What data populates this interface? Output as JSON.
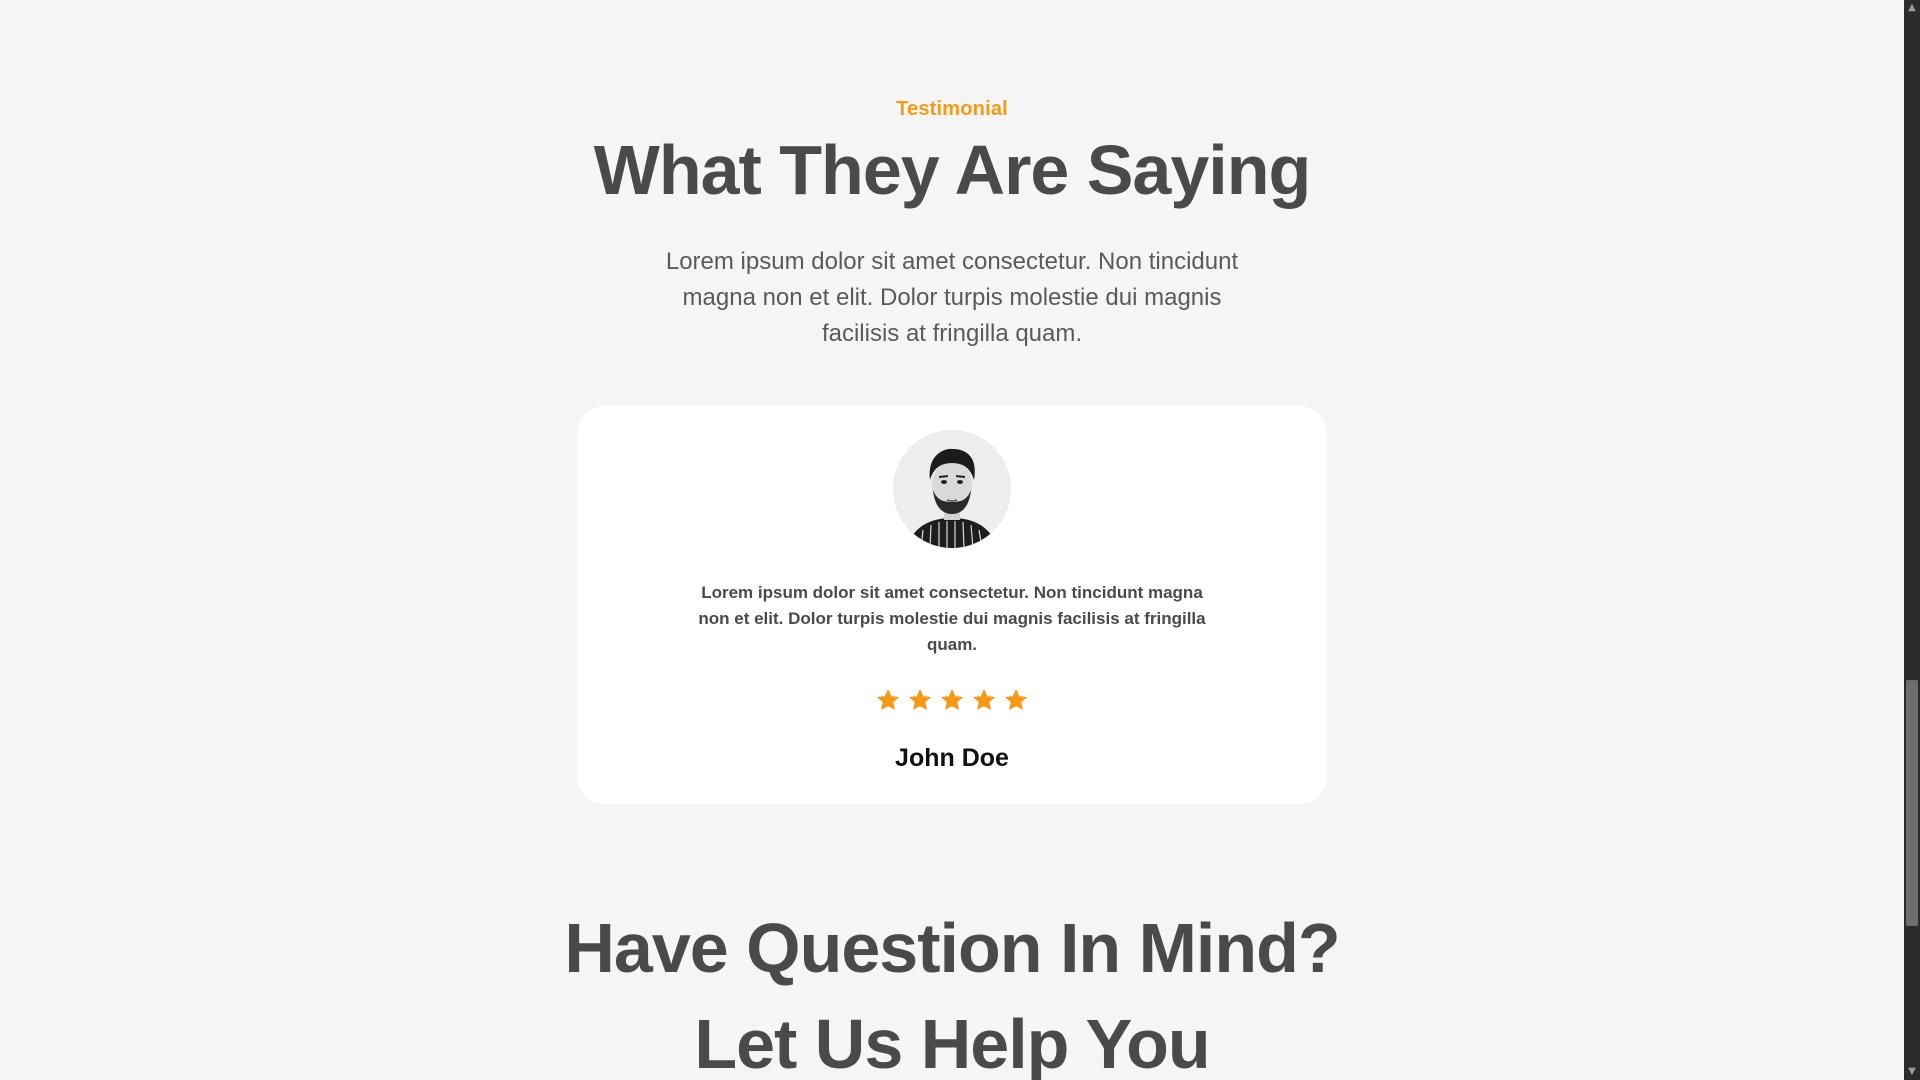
{
  "testimonial_section": {
    "eyebrow": "Testimonial",
    "title": "What They Are Saying",
    "description": "Lorem ipsum dolor sit amet consectetur. Non tincidunt magna non et elit. Dolor turpis molestie dui magnis facilisis at fringilla quam."
  },
  "testimonial_card": {
    "avatar_icon": "person-avatar",
    "quote": "Lorem ipsum dolor sit amet consectetur. Non tincidunt magna non et elit. Dolor turpis molestie dui magnis facilisis at fringilla quam.",
    "rating": 5,
    "rating_max": 5,
    "star_color": "#f59a16",
    "name": "John Doe"
  },
  "cta_section": {
    "line1": "Have Question In Mind?",
    "line2": "Let Us Help You"
  },
  "colors": {
    "accent": "#f59a16",
    "heading": "#4a4a4a",
    "background": "#f5f5f5",
    "card": "#ffffff"
  }
}
